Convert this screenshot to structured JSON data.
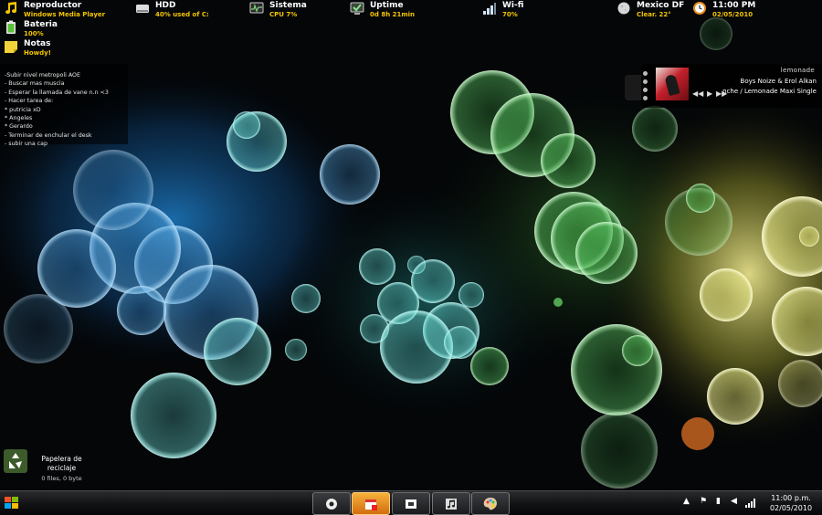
{
  "topbar": {
    "player": {
      "title": "Reproductor",
      "sub": "Windows Media Player"
    },
    "hdd": {
      "title": "HDD",
      "sub": "40% used of C:"
    },
    "system": {
      "title": "Sistema",
      "sub": "CPU 7%"
    },
    "uptime": {
      "title": "Uptime",
      "sub": "0d 8h 21min"
    },
    "wifi": {
      "title": "Wi-fi",
      "sub": "70%"
    },
    "weather": {
      "title": "Mexico DF",
      "sub": "Clear. 22°"
    },
    "clock": {
      "title": "11:00 PM",
      "sub": "02/05/2010"
    }
  },
  "sidebar": {
    "battery": {
      "title": "Bateria",
      "sub": "100%"
    },
    "notes": {
      "title": "Notas",
      "sub": "Howdy!"
    }
  },
  "notes_list": [
    "-Subir nivel metropoli AOE",
    "- Buscar mas muscia",
    "- Esperar la llamada de vane n.n <3",
    "- Hacer tarea de:",
    "* putricia xD",
    "* Angeles",
    "* Gerardo",
    "- Terminar de enchular el desk",
    "- subir una cap"
  ],
  "media_player": {
    "brand": "lemonade",
    "artist": "Boys Noize & Erol Alkan",
    "track": "nche / Lemonade Maxi Single"
  },
  "recycle_bin": {
    "label": "Papelera de reciclaje",
    "sub": "0 files, 0 byte"
  },
  "taskbar": {
    "time": "11:00 p.m.",
    "date": "02/05/2010",
    "buttons": [
      "media-center",
      "calendar",
      "window",
      "music",
      "paint"
    ]
  },
  "colors": {
    "accent_yellow": "#f4c400",
    "taskbar_active": "#e58a1f"
  }
}
